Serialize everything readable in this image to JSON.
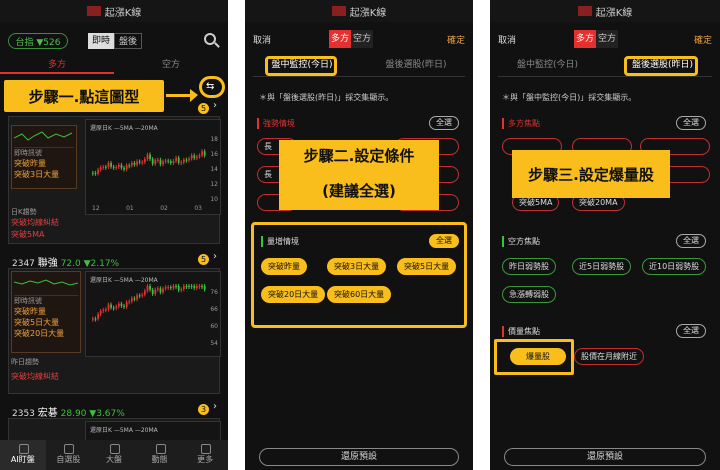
{
  "app_title": "起漲K線",
  "p1": {
    "market_label": "台指 ▼526",
    "mode_intraday": "即時",
    "mode_after": "盤後",
    "tab_long": "多方",
    "tab_short": "空方",
    "step_label": "步驟一.點這圖型",
    "stocks": [
      {
        "code": "",
        "name": "",
        "price": "",
        "change": "",
        "badge": "5",
        "signals_title": "即時訊號",
        "signals": [
          "突破昨量",
          "突破3日大量"
        ],
        "trend_title": "日K趨勢",
        "trend": [
          "突破均線糾結",
          "突破5MA"
        ],
        "chart_legend": "還原日K  —5MA —20MA",
        "axis_y": [
          "18",
          "16",
          "14",
          "12",
          "10"
        ],
        "axis_x": [
          "12",
          "01",
          "02",
          "03"
        ]
      },
      {
        "code": "2347",
        "name": "聯強",
        "price": "72.0",
        "change": "▼2.17%",
        "badge": "5",
        "signals_title": "即時訊號",
        "signals": [
          "突破昨量",
          "突破5日大量",
          "突破20日大量"
        ],
        "trend_title": "昨日趨勢",
        "trend": [
          "突破均線糾結"
        ],
        "chart_legend": "還原日K  —5MA —20MA",
        "axis_y": [
          "76",
          "66",
          "60",
          "54"
        ],
        "axis_x": []
      },
      {
        "code": "2353",
        "name": "宏碁",
        "price": "28.90",
        "change": "▼3.67%",
        "badge": "3",
        "signals_title": "",
        "signals": [],
        "trend_title": "",
        "trend": [],
        "chart_legend": "還原日K  —5MA —20MA",
        "axis_y": [],
        "axis_x": []
      }
    ],
    "nav": [
      "AI盯盤",
      "自選股",
      "大盤",
      "動態",
      "更多"
    ]
  },
  "p2": {
    "cancel": "取消",
    "long": "多方",
    "short": "空方",
    "confirm": "確定",
    "tab_intraday": "盤中監控(今日)",
    "tab_after": "盤後選股(昨日)",
    "note": "＊與「盤後選股(昨日)」採交集顯示。",
    "sec_strength": "強勢情境",
    "sec_volume": "量增情境",
    "select_all": "全選",
    "volume_pills": [
      "突破昨量",
      "突破3日大量",
      "突破5日大量",
      "突破20日大量",
      "突破60日大量"
    ],
    "strength_pills": [
      "長",
      "長",
      "",
      "",
      "",
      ""
    ],
    "step_label_1": "步驟二.設定條件",
    "step_label_2": "(建議全選)",
    "reset": "還原預設"
  },
  "p3": {
    "cancel": "取消",
    "long": "多方",
    "short": "空方",
    "confirm": "確定",
    "tab_intraday": "盤中監控(今日)",
    "tab_after": "盤後選股(昨日)",
    "note": "＊與「盤中監控(今日)」採交集顯示。",
    "sec_long": "多方焦點",
    "sec_short": "空方焦點",
    "sec_volume": "價量焦點",
    "select_all": "全選",
    "long_pills": [
      "突破5MA",
      "突破20MA"
    ],
    "short_pills": [
      "昨日弱勢股",
      "近5日弱勢股",
      "近10日弱勢股",
      "急漲轉弱股"
    ],
    "volume_pills": [
      "爆量股",
      "股價在月線附近"
    ],
    "step_label": "步驟三.設定爆量股",
    "reset": "還原預設"
  },
  "colors": {
    "accent": "#f9bd1c",
    "red": "#e53030",
    "green": "#3fbf3f"
  }
}
